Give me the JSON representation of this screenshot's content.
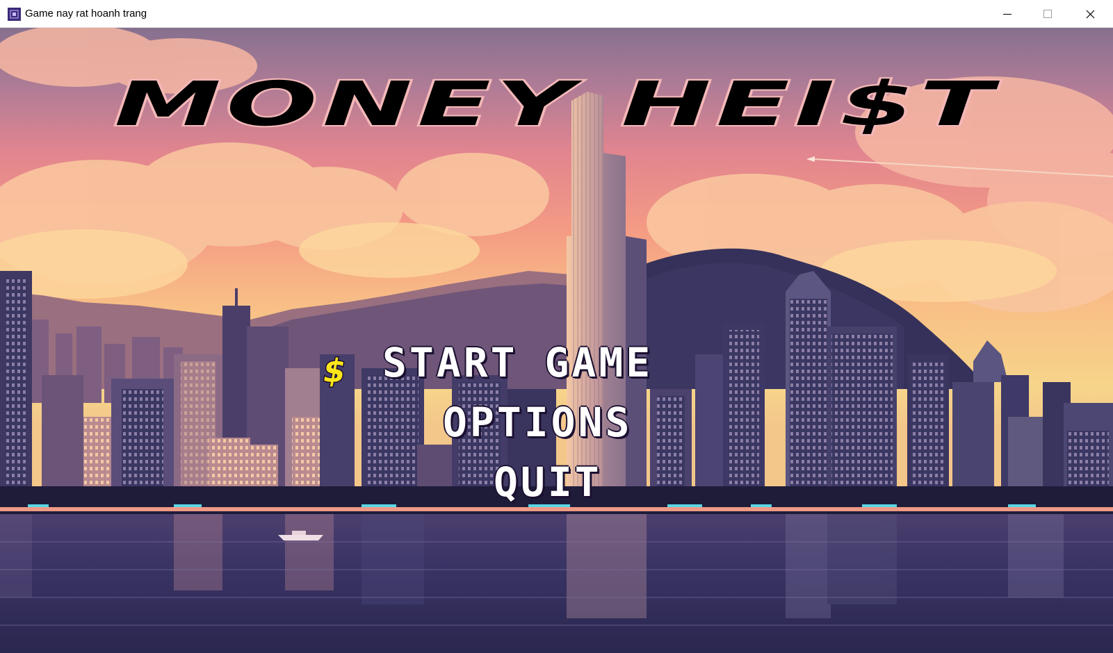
{
  "window": {
    "title": "Game nay rat hoanh trang",
    "controls": [
      "minimize-icon",
      "maximize-icon",
      "close-icon"
    ]
  },
  "game": {
    "logo_text": "MONEY HEI$T",
    "menu": {
      "items": [
        {
          "label": "START GAME",
          "selected": true
        },
        {
          "label": "OPTIONS",
          "selected": false
        },
        {
          "label": "QUIT",
          "selected": false
        }
      ],
      "cursor_icon": "dollar-sign-icon"
    },
    "background": "city-skyline-sunset",
    "colors": {
      "menu_text": "#ffffff",
      "cursor": "#ffe61a",
      "logo_fill": "#000000",
      "logo_outline": "#f2b5b5",
      "sky_top": "#86708f",
      "sky_bottom": "#f6d58a",
      "water": "#2f2a55"
    }
  }
}
